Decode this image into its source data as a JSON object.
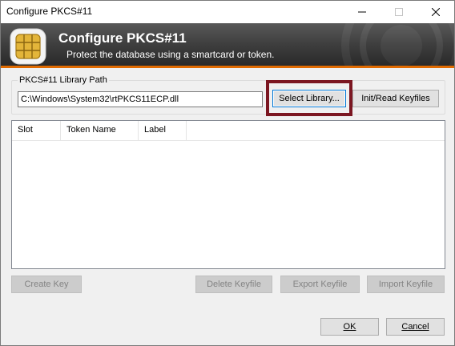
{
  "window": {
    "title": "Configure PKCS#11"
  },
  "banner": {
    "title": "Configure PKCS#11",
    "subtitle": "Protect the database using a smartcard or token.",
    "icon": "smartcard-chip-icon"
  },
  "library_path": {
    "group_label": "PKCS#11 Library Path",
    "value": "C:\\Windows\\System32\\rtPKCS11ECP.dll"
  },
  "buttons": {
    "select_library": "Select Library...",
    "init_read_keyfiles": "Init/Read Keyfiles",
    "create_key": "Create Key",
    "delete_keyfile": "Delete Keyfile",
    "export_keyfile": "Export Keyfile",
    "import_keyfile": "Import Keyfile",
    "ok": "OK",
    "cancel": "Cancel"
  },
  "list": {
    "columns": [
      "Slot",
      "Token Name",
      "Label"
    ],
    "rows": []
  },
  "colors": {
    "highlight": "#7b1621",
    "banner_accent": "#e06a00",
    "focus": "#0078d7"
  }
}
